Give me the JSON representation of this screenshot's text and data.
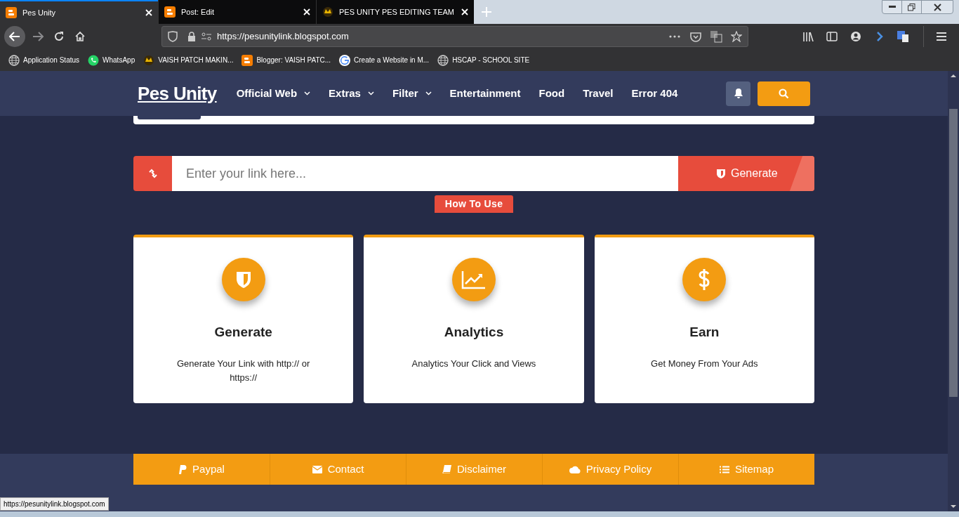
{
  "browser": {
    "tabs": [
      {
        "title": "Pes Unity",
        "selected": true,
        "kind": "blogger"
      },
      {
        "title": "Post: Edit",
        "selected": false,
        "kind": "blogger"
      },
      {
        "title": "PES UNITY PES EDITING TEAM",
        "selected": false,
        "kind": "logo"
      }
    ],
    "url": "https://pesunitylink.blogspot.com",
    "bookmarks": [
      {
        "label": "Application Status",
        "kind": "globe"
      },
      {
        "label": "WhatsApp",
        "kind": "whatsapp"
      },
      {
        "label": "VAISH PATCH MAKIN...",
        "kind": "logo"
      },
      {
        "label": "Blogger: VAISH PATC...",
        "kind": "blogger"
      },
      {
        "label": "Create a Website in M...",
        "kind": "google"
      },
      {
        "label": "HSCAP - SCHOOL SITE",
        "kind": "globe"
      }
    ],
    "status_url": "https://pesunitylink.blogspot.com"
  },
  "site": {
    "logo": "Pes Unity",
    "nav": [
      {
        "label": "Official Web",
        "dropdown": true
      },
      {
        "label": "Extras",
        "dropdown": true
      },
      {
        "label": "Filter",
        "dropdown": true
      },
      {
        "label": "Entertainment",
        "dropdown": false
      },
      {
        "label": "Food",
        "dropdown": false
      },
      {
        "label": "Travel",
        "dropdown": false
      },
      {
        "label": "Error 404",
        "dropdown": false
      }
    ],
    "link_placeholder": "Enter your link here...",
    "generate_button": "Generate",
    "how_to_use": "How To Use",
    "features": [
      {
        "kind": "shield",
        "title": "Generate",
        "text": "Generate Your Link with http:// or https://"
      },
      {
        "kind": "chart",
        "title": "Analytics",
        "text": "Analytics Your Click and Views"
      },
      {
        "kind": "dollar",
        "title": "Earn",
        "text": "Get Money From Your Ads"
      }
    ],
    "footer_links": [
      {
        "kind": "paypal",
        "label": "Paypal"
      },
      {
        "kind": "envelope",
        "label": "Contact"
      },
      {
        "kind": "book",
        "label": "Disclaimer"
      },
      {
        "kind": "cloud",
        "label": "Privacy Policy"
      },
      {
        "kind": "list",
        "label": "Sitemap"
      }
    ]
  }
}
